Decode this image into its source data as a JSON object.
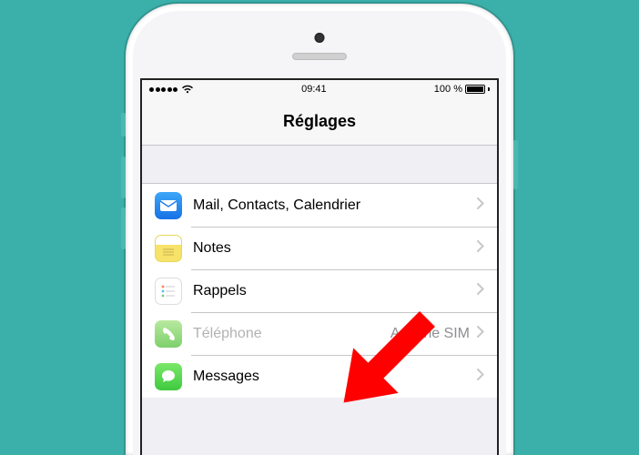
{
  "statusbar": {
    "time": "09:41",
    "battery": "100 %"
  },
  "navbar": {
    "title": "Réglages"
  },
  "rows": [
    {
      "label": "Mail, Contacts, Calendrier",
      "detail": ""
    },
    {
      "label": "Notes",
      "detail": ""
    },
    {
      "label": "Rappels",
      "detail": ""
    },
    {
      "label": "Téléphone",
      "detail": "Aucune SIM"
    },
    {
      "label": "Messages",
      "detail": ""
    }
  ]
}
